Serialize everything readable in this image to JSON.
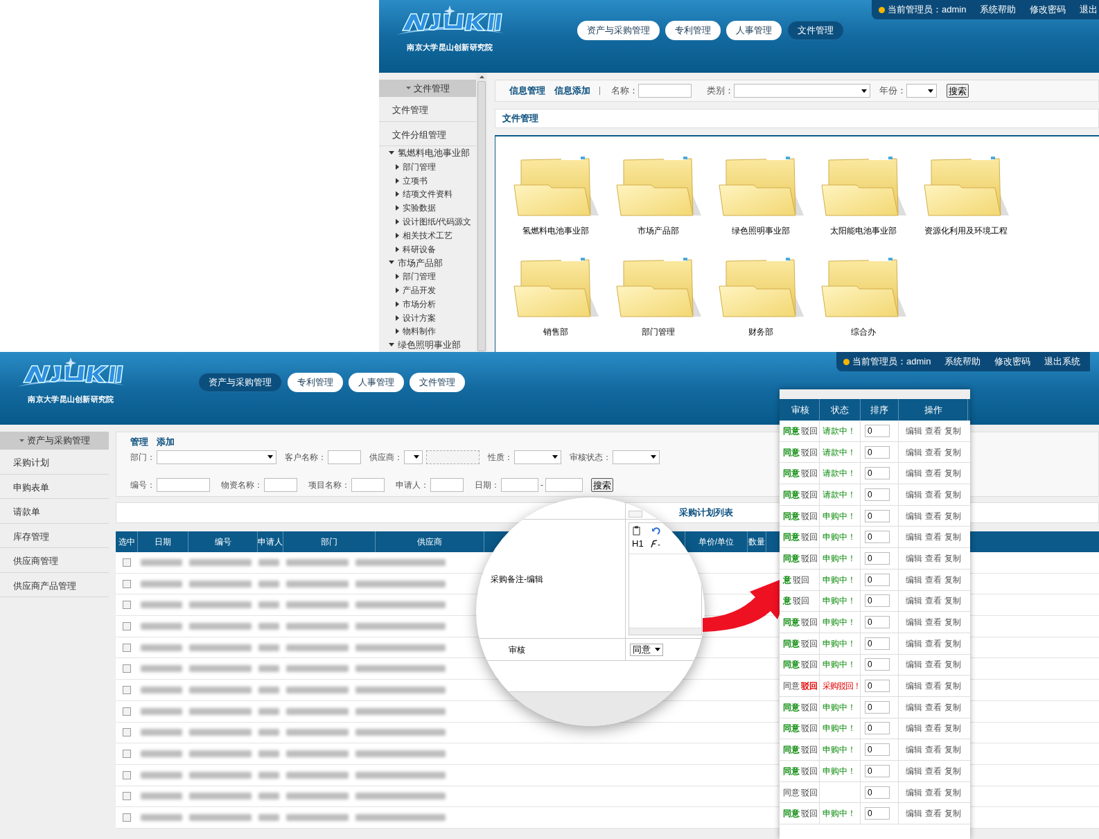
{
  "top_screen": {
    "header": {
      "logo_subtitle": "南京大学昆山创新研究院",
      "nav_tabs": [
        {
          "label": "资产与采购管理",
          "selected": false
        },
        {
          "label": "专利管理",
          "selected": false
        },
        {
          "label": "人事管理",
          "selected": false
        },
        {
          "label": "文件管理",
          "selected": true
        }
      ],
      "admin_label": "当前管理员：admin",
      "links": [
        "系统帮助",
        "修改密码",
        "退出"
      ]
    },
    "sidebar": {
      "header": "文件管理",
      "items": [
        "文件管理",
        "文件分组管理"
      ],
      "tree": [
        {
          "label": "氢燃料电池事业部",
          "expanded": true,
          "children": [
            {
              "label": "部门管理",
              "expanded": false
            },
            {
              "label": "立项书",
              "expanded": false
            },
            {
              "label": "结项文件资料",
              "expanded": false
            },
            {
              "label": "实验数据",
              "expanded": false
            },
            {
              "label": "设计图纸/代码源文",
              "expanded": false
            },
            {
              "label": "相关技术工艺",
              "expanded": false
            },
            {
              "label": "科研设备",
              "expanded": false
            }
          ]
        },
        {
          "label": "市场产品部",
          "expanded": true,
          "children": [
            {
              "label": "部门管理",
              "expanded": false
            },
            {
              "label": "产品开发",
              "expanded": false
            },
            {
              "label": "市场分析",
              "expanded": false
            },
            {
              "label": "设计方案",
              "expanded": false
            },
            {
              "label": "物料制作",
              "expanded": false
            }
          ]
        },
        {
          "label": "绿色照明事业部",
          "expanded": true
        }
      ]
    },
    "toolbar": {
      "links": [
        "信息管理",
        "信息添加"
      ],
      "name_label": "名称：",
      "category_label": "类别：",
      "year_label": "年份：",
      "search_button": "搜索"
    },
    "section_title": "文件管理",
    "folders": [
      "氢燃料电池事业部",
      "市场产品部",
      "绿色照明事业部",
      "太阳能电池事业部",
      "资源化利用及环境工程",
      "销售部",
      "部门管理",
      "财务部",
      "综合办"
    ]
  },
  "bottom_screen": {
    "header": {
      "logo_subtitle": "南京大学昆山创新研究院",
      "nav_tabs": [
        {
          "label": "资产与采购管理",
          "selected": true
        },
        {
          "label": "专利管理",
          "selected": false
        },
        {
          "label": "人事管理",
          "selected": false
        },
        {
          "label": "文件管理",
          "selected": false
        }
      ],
      "admin_label": "当前管理员：admin",
      "links": [
        "系统帮助",
        "修改密码",
        "退出系统"
      ]
    },
    "sidebar": {
      "header": "资产与采购管理",
      "items": [
        "采购计划",
        "申购表单",
        "请款单",
        "库存管理",
        "供应商管理",
        "供应商产品管理"
      ]
    },
    "filters": {
      "links": [
        "管理",
        "添加"
      ],
      "row_1": [
        {
          "label": "部门：",
          "kind": "select"
        },
        {
          "label": "客户名称：",
          "kind": "input"
        },
        {
          "label": "供应商：",
          "kind": "supplier"
        },
        {
          "label": "性质：",
          "kind": "select"
        },
        {
          "label": "审核状态：",
          "kind": "select"
        }
      ],
      "row_2": [
        {
          "label": "编号：",
          "kind": "input"
        },
        {
          "label": "物资名称：",
          "kind": "input"
        },
        {
          "label": "项目名称：",
          "kind": "input"
        },
        {
          "label": "申请人：",
          "kind": "input"
        },
        {
          "label": "日期：",
          "kind": "date_range",
          "separator": "-"
        }
      ],
      "search_button": "搜索"
    },
    "table": {
      "title": "采购计划列表",
      "columns": [
        "选中",
        "日期",
        "编号",
        "申请人",
        "部门",
        "供应商",
        "",
        "单价/单位",
        "数量"
      ],
      "rows": [
        {
          "checked": false
        },
        {
          "checked": false
        },
        {
          "checked": false
        },
        {
          "checked": false
        },
        {
          "checked": false
        },
        {
          "checked": false
        },
        {
          "checked": false
        },
        {
          "checked": false
        },
        {
          "checked": false
        },
        {
          "checked": false
        },
        {
          "checked": false
        },
        {
          "checked": false
        },
        {
          "checked": false
        }
      ]
    }
  },
  "magnifier": {
    "note_label": "采购备注-编辑",
    "editor_heading": "H1",
    "review_label": "审核",
    "review_value": "同意"
  },
  "review_table": {
    "columns": [
      "审核",
      "状态",
      "排序",
      "操作"
    ],
    "rows": [
      {
        "agree": "同意",
        "reject": "驳回",
        "agreed": true,
        "rejected": false,
        "status": "请款中！",
        "order": "0",
        "actions": [
          "编辑",
          "查看",
          "复制"
        ]
      },
      {
        "agree": "同意",
        "reject": "驳回",
        "agreed": true,
        "rejected": false,
        "status": "请款中！",
        "order": "0",
        "actions": [
          "编辑",
          "查看",
          "复制"
        ]
      },
      {
        "agree": "同意",
        "reject": "驳回",
        "agreed": true,
        "rejected": false,
        "status": "请款中！",
        "order": "0",
        "actions": [
          "编辑",
          "查看",
          "复制"
        ]
      },
      {
        "agree": "同意",
        "reject": "驳回",
        "agreed": true,
        "rejected": false,
        "status": "请款中！",
        "order": "0",
        "actions": [
          "编辑",
          "查看",
          "复制"
        ]
      },
      {
        "agree": "同意",
        "reject": "驳回",
        "agreed": true,
        "rejected": false,
        "status": "申购中！",
        "order": "0",
        "actions": [
          "编辑",
          "查看",
          "复制"
        ]
      },
      {
        "agree": "同意",
        "reject": "驳回",
        "agreed": true,
        "rejected": false,
        "status": "申购中！",
        "order": "0",
        "actions": [
          "编辑",
          "查看",
          "复制"
        ]
      },
      {
        "agree": "同意",
        "reject": "驳回",
        "agreed": true,
        "rejected": false,
        "status": "申购中！",
        "order": "0",
        "actions": [
          "编辑",
          "查看",
          "复制"
        ]
      },
      {
        "agree": "意",
        "reject": "驳回",
        "agreed": true,
        "rejected": false,
        "status": "申购中！",
        "order": "0",
        "actions": [
          "编辑",
          "查看",
          "复制"
        ]
      },
      {
        "agree": "意",
        "reject": "驳回",
        "agreed": true,
        "rejected": false,
        "status": "申购中！",
        "order": "0",
        "actions": [
          "编辑",
          "查看",
          "复制"
        ]
      },
      {
        "agree": "同意",
        "reject": "驳回",
        "agreed": true,
        "rejected": false,
        "status": "申购中！",
        "order": "0",
        "actions": [
          "编辑",
          "查看",
          "复制"
        ]
      },
      {
        "agree": "同意",
        "reject": "驳回",
        "agreed": true,
        "rejected": false,
        "status": "申购中！",
        "order": "0",
        "actions": [
          "编辑",
          "查看",
          "复制"
        ]
      },
      {
        "agree": "同意",
        "reject": "驳回",
        "agreed": true,
        "rejected": false,
        "status": "申购中！",
        "order": "0",
        "actions": [
          "编辑",
          "查看",
          "复制"
        ]
      },
      {
        "agree": "同意",
        "reject": "驳回",
        "agreed": false,
        "rejected": true,
        "status": "采购驳回！",
        "order": "0",
        "actions": [
          "编辑",
          "查看",
          "复制"
        ]
      },
      {
        "agree": "同意",
        "reject": "驳回",
        "agreed": true,
        "rejected": false,
        "status": "申购中！",
        "order": "0",
        "actions": [
          "编辑",
          "查看",
          "复制"
        ]
      },
      {
        "agree": "同意",
        "reject": "驳回",
        "agreed": true,
        "rejected": false,
        "status": "申购中！",
        "order": "0",
        "actions": [
          "编辑",
          "查看",
          "复制"
        ]
      },
      {
        "agree": "同意",
        "reject": "驳回",
        "agreed": true,
        "rejected": false,
        "status": "申购中！",
        "order": "0",
        "actions": [
          "编辑",
          "查看",
          "复制"
        ]
      },
      {
        "agree": "同意",
        "reject": "驳回",
        "agreed": true,
        "rejected": false,
        "status": "申购中！",
        "order": "0",
        "actions": [
          "编辑",
          "查看",
          "复制"
        ]
      },
      {
        "agree": "同意",
        "reject": "驳回",
        "agreed": false,
        "rejected": false,
        "order": "0",
        "actions": [
          "编辑",
          "查看",
          "复制"
        ]
      },
      {
        "agree": "同意",
        "reject": "驳回",
        "agreed": true,
        "rejected": false,
        "status": "申购中！",
        "order": "0",
        "actions": [
          "编辑",
          "查看",
          "复制"
        ]
      }
    ]
  }
}
